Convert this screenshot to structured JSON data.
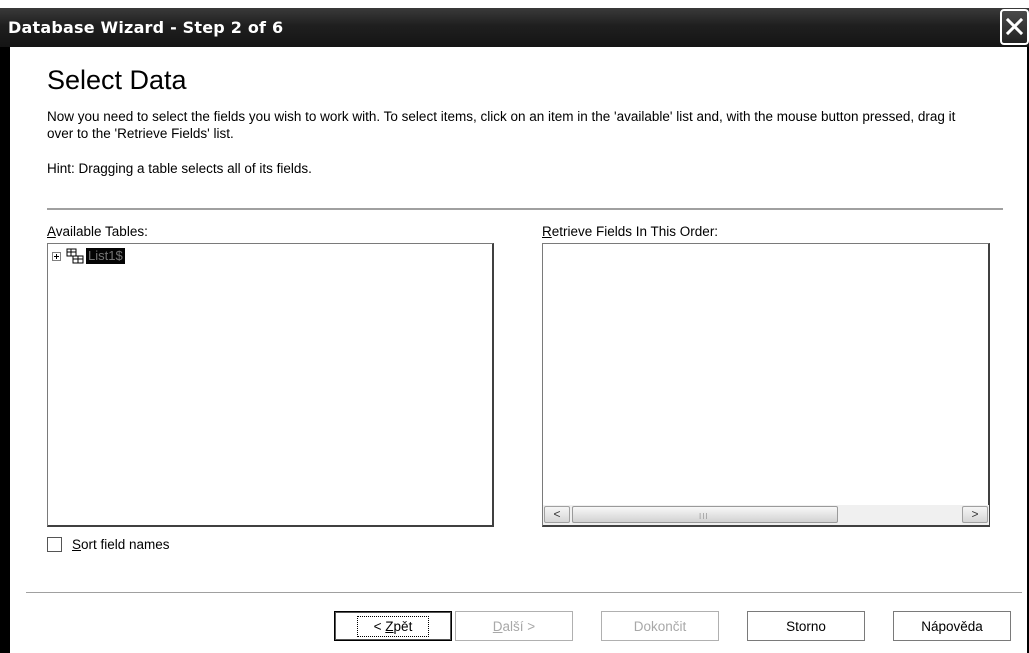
{
  "window": {
    "title": "Database Wizard - Step 2 of 6",
    "close_icon": "close-icon"
  },
  "page": {
    "heading": "Select Data",
    "description": "Now you need to select the fields you wish to work with. To select items, click on an item in the 'available' list and, with the mouse button pressed, drag it over to the 'Retrieve Fields' list.",
    "hint": "Hint: Dragging a table selects all of its fields."
  },
  "available_tables": {
    "label_mnemonic": "A",
    "label_rest": "vailable Tables:",
    "items": [
      {
        "label": "List1$",
        "expanded": false,
        "selected": true,
        "icon": "table-icon"
      }
    ]
  },
  "retrieve_fields": {
    "label_mnemonic": "R",
    "label_rest": "etrieve Fields In This Order:",
    "items": [],
    "scroll_left_glyph": "<",
    "scroll_right_glyph": ">",
    "scroll_grip": "III"
  },
  "sort_option": {
    "label_mnemonic": "S",
    "label_rest": "ort field names",
    "checked": false
  },
  "buttons": {
    "back": {
      "prefix": "< ",
      "mnemonic": "Z",
      "rest": "pět",
      "enabled": true,
      "default": true
    },
    "next": {
      "prefix": "",
      "mnemonic": "D",
      "rest": "alší >",
      "enabled": false
    },
    "finish": {
      "label": "Dokončit",
      "enabled": false
    },
    "cancel": {
      "label": "Storno",
      "enabled": true
    },
    "help": {
      "label": "Nápověda",
      "enabled": true
    }
  }
}
